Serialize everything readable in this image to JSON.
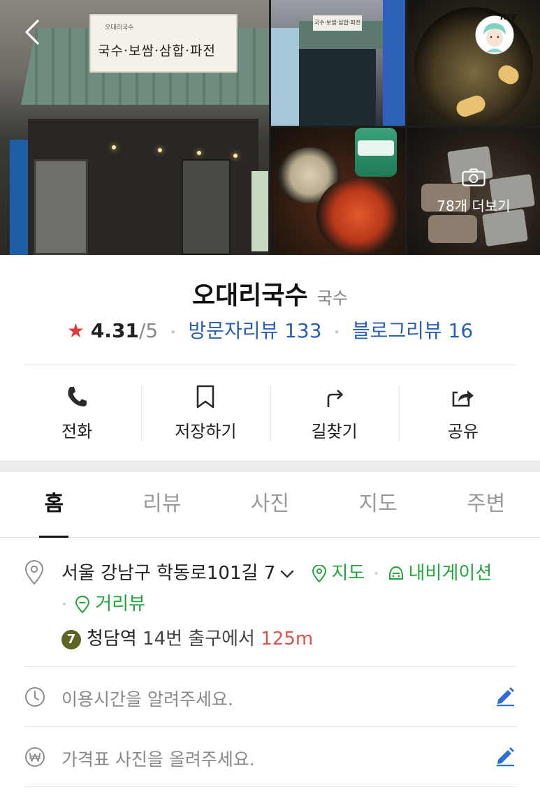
{
  "photos": {
    "sign_text": "국수·보쌈·삼합·파전",
    "sign_sub": "오대리국수",
    "p2_sign": "국수·보쌈·삼합·파전",
    "more_label": "78개 더보기",
    "back_icon": "chevron-left-icon",
    "avatar_text": "my"
  },
  "place": {
    "name": "오대리국수",
    "category": "국수",
    "rating": "4.31",
    "rating_outof": "/5",
    "visitor_review_label": "방문자리뷰 133",
    "blog_review_label": "블로그리뷰 16"
  },
  "actions": [
    {
      "label": "전화",
      "icon": "phone-icon"
    },
    {
      "label": "저장하기",
      "icon": "bookmark-icon"
    },
    {
      "label": "길찾기",
      "icon": "directions-icon"
    },
    {
      "label": "공유",
      "icon": "share-icon"
    }
  ],
  "tabs": [
    {
      "label": "홈",
      "active": true
    },
    {
      "label": "리뷰",
      "active": false
    },
    {
      "label": "사진",
      "active": false
    },
    {
      "label": "지도",
      "active": false
    },
    {
      "label": "주변",
      "active": false
    }
  ],
  "address": {
    "text": "서울 강남구 학동로101길 7",
    "map_link": "지도",
    "navigation_link": "내비게이션",
    "streetview_link": "거리뷰"
  },
  "subway": {
    "line_number": "7",
    "station": "청담역",
    "exit": "14번 출구에서",
    "distance": "125m",
    "line_color": "#5f6323"
  },
  "info": {
    "hours_prompt": "이용시간을 알려주세요.",
    "price_prompt": "가격표 사진을 올려주세요."
  },
  "colors": {
    "link_blue": "#2b5fb5",
    "link_green": "#22a63c",
    "star_red": "#e03b3b",
    "distance_red": "#e2514a",
    "edit_blue": "#2d6fd6"
  }
}
